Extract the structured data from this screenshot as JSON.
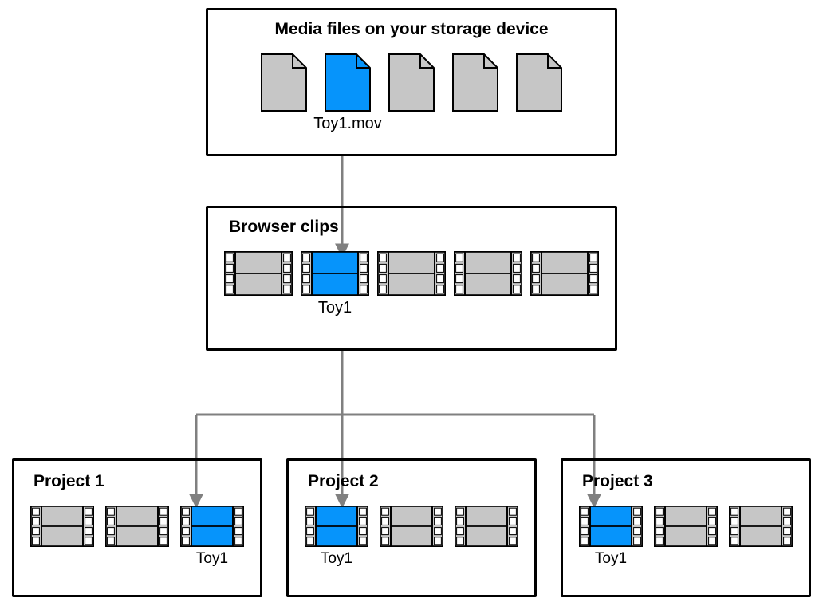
{
  "colors": {
    "accent": "#0694FB",
    "gray": "#C6C6C6",
    "stroke": "#000000",
    "arrow": "#808080"
  },
  "storage": {
    "title": "Media files on your storage device",
    "files": [
      {
        "highlighted": false,
        "label": ""
      },
      {
        "highlighted": true,
        "label": "Toy1.mov"
      },
      {
        "highlighted": false,
        "label": ""
      },
      {
        "highlighted": false,
        "label": ""
      },
      {
        "highlighted": false,
        "label": ""
      }
    ]
  },
  "browser": {
    "title": "Browser clips",
    "clips": [
      {
        "highlighted": false,
        "label": ""
      },
      {
        "highlighted": true,
        "label": "Toy1"
      },
      {
        "highlighted": false,
        "label": ""
      },
      {
        "highlighted": false,
        "label": ""
      },
      {
        "highlighted": false,
        "label": ""
      }
    ]
  },
  "projects": [
    {
      "title": "Project 1",
      "clips": [
        {
          "highlighted": false,
          "label": ""
        },
        {
          "highlighted": false,
          "label": ""
        },
        {
          "highlighted": true,
          "label": "Toy1"
        }
      ]
    },
    {
      "title": "Project 2",
      "clips": [
        {
          "highlighted": true,
          "label": "Toy1"
        },
        {
          "highlighted": false,
          "label": ""
        },
        {
          "highlighted": false,
          "label": ""
        }
      ]
    },
    {
      "title": "Project 3",
      "clips": [
        {
          "highlighted": true,
          "label": "Toy1"
        },
        {
          "highlighted": false,
          "label": ""
        },
        {
          "highlighted": false,
          "label": ""
        }
      ]
    }
  ]
}
